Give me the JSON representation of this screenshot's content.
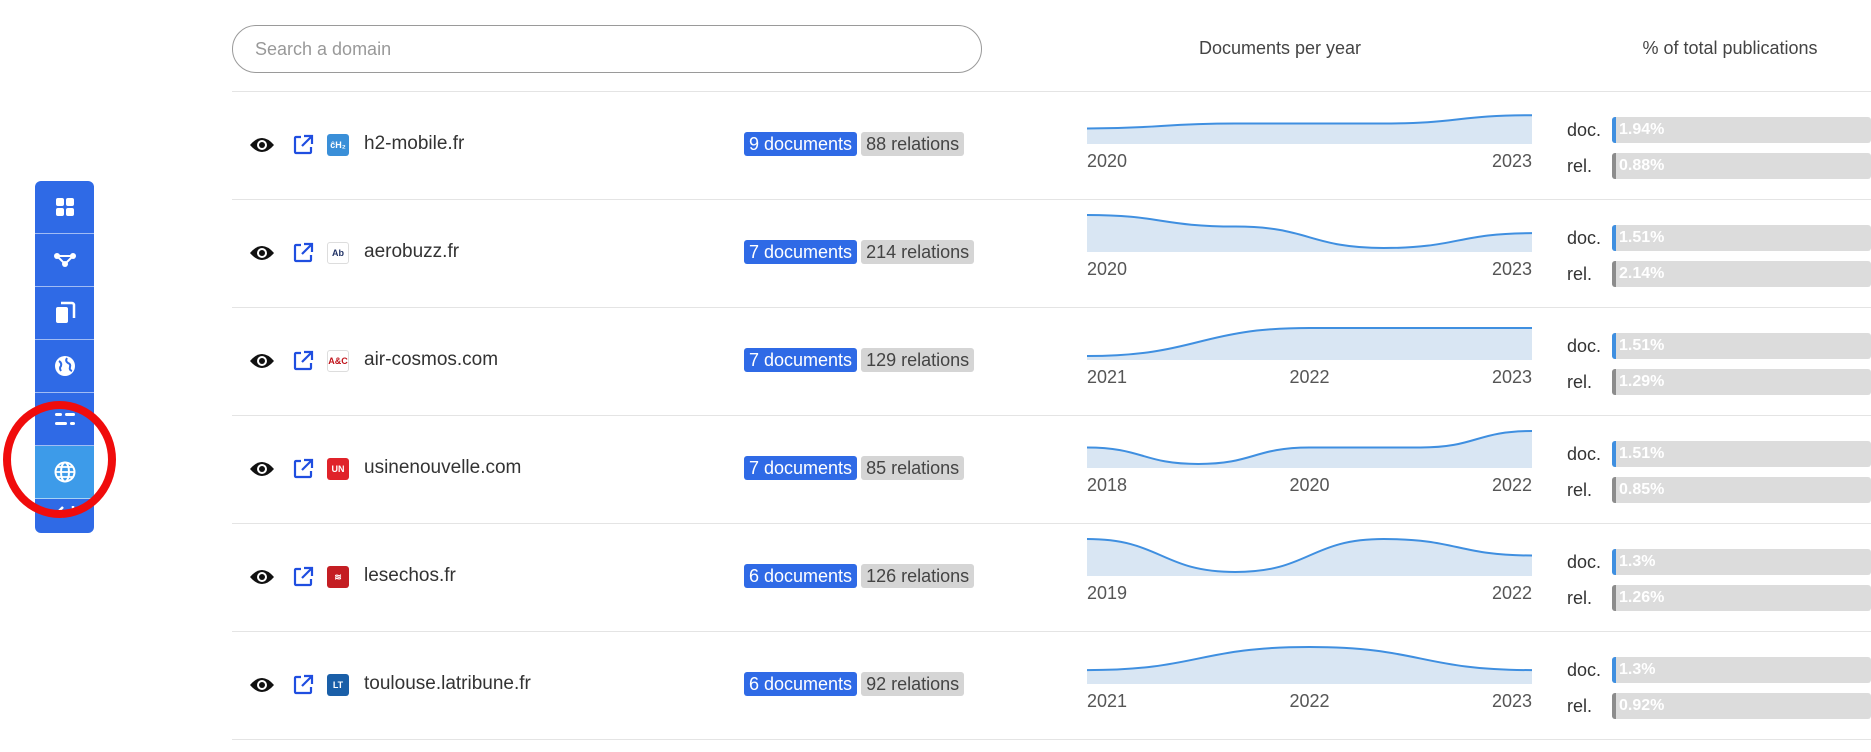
{
  "search": {
    "placeholder": "Search a domain",
    "value": ""
  },
  "columns": {
    "docs_per_year": "Documents per year",
    "pct_total": "% of total publications"
  },
  "sidebar": {
    "items": [
      {
        "icon": "dashboard-icon",
        "active": false
      },
      {
        "icon": "graph-icon",
        "active": false
      },
      {
        "icon": "documents-icon",
        "active": false
      },
      {
        "icon": "globe-icon",
        "active": false
      },
      {
        "icon": "filters-icon",
        "active": false
      },
      {
        "icon": "domains-globe-icon",
        "active": true
      },
      {
        "icon": "back-arrow-icon",
        "active": false
      }
    ]
  },
  "labels": {
    "doc": "doc.",
    "rel": "rel."
  },
  "rows": [
    {
      "domain": "h2-mobile.fr",
      "favicon": "ĉH₂",
      "favicon_bg": "#3a8fd8",
      "favicon_fg": "#ffffff",
      "documents": "9 documents",
      "relations": "88 relations",
      "spark": {
        "labels": [
          "2020",
          "2023"
        ],
        "values": [
          0.35,
          0.5,
          0.5,
          0.75
        ]
      },
      "doc_pct": "1.94%",
      "doc_frac": 0.0194,
      "rel_pct": "0.88%",
      "rel_frac": 0.0088
    },
    {
      "domain": "aerobuzz.fr",
      "favicon": "Ab",
      "favicon_bg": "#ffffff",
      "favicon_fg": "#223366",
      "documents": "7 documents",
      "relations": "214 relations",
      "spark": {
        "labels": [
          "2020",
          "2023"
        ],
        "values": [
          1.0,
          0.65,
          0.0,
          0.45
        ]
      },
      "doc_pct": "1.51%",
      "doc_frac": 0.0151,
      "rel_pct": "2.14%",
      "rel_frac": 0.0214
    },
    {
      "domain": "air-cosmos.com",
      "favicon": "A&C",
      "favicon_bg": "#ffffff",
      "favicon_fg": "#c0141b",
      "documents": "7 documents",
      "relations": "129 relations",
      "spark": {
        "labels": [
          "2021",
          "2022",
          "2023"
        ],
        "values": [
          0.0,
          0.85,
          0.85
        ]
      },
      "doc_pct": "1.51%",
      "doc_frac": 0.0151,
      "rel_pct": "1.29%",
      "rel_frac": 0.0129
    },
    {
      "domain": "usinenouvelle.com",
      "favicon": "UN",
      "favicon_bg": "#e0232a",
      "favicon_fg": "#ffffff",
      "documents": "7 documents",
      "relations": "85 relations",
      "spark": {
        "labels": [
          "2018",
          "2020",
          "2022"
        ],
        "values": [
          0.5,
          0.0,
          0.5,
          0.5,
          1.0
        ]
      },
      "doc_pct": "1.51%",
      "doc_frac": 0.0151,
      "rel_pct": "0.85%",
      "rel_frac": 0.0085
    },
    {
      "domain": "lesechos.fr",
      "favicon": "≋",
      "favicon_bg": "#c41e23",
      "favicon_fg": "#ffffff",
      "documents": "6 documents",
      "relations": "126 relations",
      "spark": {
        "labels": [
          "2019",
          "2022"
        ],
        "values": [
          1.0,
          0.0,
          1.0,
          0.5
        ]
      },
      "doc_pct": "1.3%",
      "doc_frac": 0.013,
      "rel_pct": "1.26%",
      "rel_frac": 0.0126
    },
    {
      "domain": "toulouse.latribune.fr",
      "favicon": "LT",
      "favicon_bg": "#1a5fa8",
      "favicon_fg": "#ffffff",
      "documents": "6 documents",
      "relations": "92 relations",
      "spark": {
        "labels": [
          "2021",
          "2022",
          "2023"
        ],
        "values": [
          0.3,
          1.0,
          0.3
        ]
      },
      "doc_pct": "1.3%",
      "doc_frac": 0.013,
      "rel_pct": "0.92%",
      "rel_frac": 0.0092
    }
  ]
}
